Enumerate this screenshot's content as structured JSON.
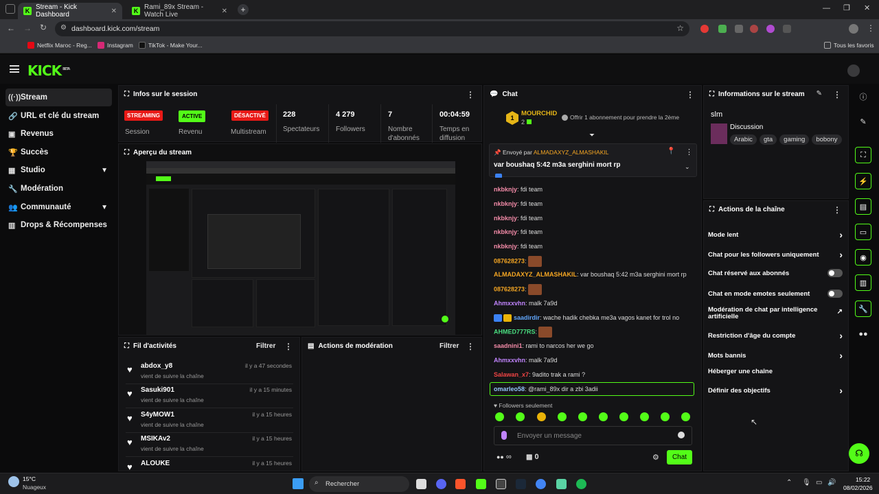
{
  "browser": {
    "tabs": [
      {
        "label": "Stream - Kick Dashboard"
      },
      {
        "label": "Rami_89x Stream - Watch Live"
      }
    ],
    "url": "dashboard.kick.com/stream",
    "bookmarks": [
      "Netflix Maroc - Reg...",
      "Instagram",
      "TikTok - Make Your..."
    ],
    "all_bookmarks": "Tous les favoris"
  },
  "header": {
    "logo": "KICK",
    "beta": "BETA"
  },
  "sidebar": {
    "items": [
      {
        "label": "Stream",
        "icon": "broadcast-icon"
      },
      {
        "label": "URL et clé du stream",
        "icon": "link-icon"
      },
      {
        "label": "Revenus",
        "icon": "wallet-icon"
      },
      {
        "label": "Succès",
        "icon": "trophy-icon"
      },
      {
        "label": "Studio",
        "icon": "studio-icon"
      },
      {
        "label": "Modération",
        "icon": "wrench-icon"
      },
      {
        "label": "Communauté",
        "icon": "people-icon"
      },
      {
        "label": "Drops & Récompenses",
        "icon": "drops-icon"
      }
    ]
  },
  "session": {
    "title": "Infos sur le session",
    "streaming_badge": "STREAMING",
    "streaming_label": "Session",
    "active_badge": "ACTIVE",
    "active_label": "Revenu Partenaire",
    "multi_badge": "DÉSACTIVÉ",
    "multi_label": "Multistream",
    "viewers_val": "228",
    "viewers_label": "Spectateurs",
    "followers_val": "4 279",
    "followers_label": "Followers",
    "subs_val": "7",
    "subs_label": "Nombre d'abonnés",
    "time_val": "00:04:59",
    "time_label": "Temps en diffusion"
  },
  "preview": {
    "title": "Aperçu du stream"
  },
  "activity": {
    "title": "Fil d'activités",
    "filter": "Filtrer",
    "items": [
      {
        "name": "abdox_y8",
        "sub": "vient de suivre la chaîne",
        "time": "il y a 47 secondes"
      },
      {
        "name": "Sasuki901",
        "sub": "vient de suivre la chaîne",
        "time": "il y a 15 minutes"
      },
      {
        "name": "S4yMOW1",
        "sub": "vient de suivre la chaîne",
        "time": "il y a 15 heures"
      },
      {
        "name": "MSIKAv2",
        "sub": "vient de suivre la chaîne",
        "time": "il y a 15 heures"
      },
      {
        "name": "ALOUKE",
        "sub": "",
        "time": "il y a 15 heures"
      }
    ]
  },
  "moderation": {
    "title": "Actions de modération",
    "filter": "Filtrer"
  },
  "chat": {
    "title": "Chat",
    "top_user": "MOURCHID",
    "top_count": "2",
    "top_rank": "1",
    "offer": "Offrir 1 abonnement pour prendre la 2ème",
    "pinned_by_label": "Envoyé par",
    "pinned_by": "ALMADAXYZ_ALMASHAKIL",
    "pinned_msg": "var boushaq 5:42 m3a serghini mort rp",
    "messages": [
      {
        "user": "nkbknjy",
        "text": ": fdi team",
        "color": "#f38ba8"
      },
      {
        "user": "nkbknjy",
        "text": ": fdi team",
        "color": "#f38ba8"
      },
      {
        "user": "nkbknjy",
        "text": ": fdi team",
        "color": "#f38ba8"
      },
      {
        "user": "nkbknjy",
        "text": ": fdi team",
        "color": "#f38ba8"
      },
      {
        "user": "nkbknjy",
        "text": ": fdi team",
        "color": "#f38ba8"
      },
      {
        "user": "087628273",
        "text": ":",
        "color": "#f5a623"
      },
      {
        "user": "ALMADAXYZ_ALMASHAKIL",
        "text": ": var boushaq 5:42 m3a serghini mort rp",
        "color": "#f5a623"
      },
      {
        "user": "087628273",
        "text": ":",
        "color": "#f5a623"
      },
      {
        "user": "Ahmxxvhn",
        "text": ": malk 7a9d",
        "color": "#c084fc"
      },
      {
        "user": "saadirdir",
        "text": ": wache hadik chebka me3a vagos kanet for trol no",
        "color": "#60a5fa"
      },
      {
        "user": "AHMED777RS",
        "text": ":",
        "color": "#4ade80"
      },
      {
        "user": "saadnini1",
        "text": ": rami to narcos her we go",
        "color": "#f38ba8"
      },
      {
        "user": "Ahmxxvhn",
        "text": ": malk 7a9d",
        "color": "#c084fc"
      },
      {
        "user": "Salawan_x7",
        "text": ": 9adito trak a rami ?",
        "color": "#ef4444"
      },
      {
        "user": "omarleo58",
        "text": ": @rami_89x dir a zbi 3adii",
        "color": "#93c5fd"
      }
    ],
    "followers_only": "Followers seulement",
    "input_placeholder": "Envoyer un message",
    "infinity": "∞",
    "gift_count": "0",
    "send": "Chat"
  },
  "stream_info": {
    "title": "Informations sur le stream",
    "stream_title": "slm",
    "category": "Discussion",
    "tags": [
      "Arabic",
      "gta",
      "gaming",
      "bobony"
    ]
  },
  "channel_actions": {
    "title": "Actions de la chaîne",
    "items": [
      {
        "label": "Mode lent",
        "control": "arrow"
      },
      {
        "label": "Chat pour les followers uniquement",
        "control": "arrow"
      },
      {
        "label": "Chat réservé aux abonnés",
        "control": "toggle"
      },
      {
        "label": "Chat en mode emotes seulement",
        "control": "toggle"
      },
      {
        "label": "Modération de chat par intelligence artificielle",
        "control": "external"
      },
      {
        "label": "Restriction d'âge du compte",
        "control": "arrow"
      },
      {
        "label": "Mots bannis",
        "control": "arrow"
      },
      {
        "label": "Héberger une chaîne",
        "control": "none"
      },
      {
        "label": "Définir des objectifs",
        "control": "arrow"
      }
    ]
  },
  "taskbar": {
    "weather_temp": "15°C",
    "weather_desc": "Nuageux",
    "search": "Rechercher",
    "time": "15:22",
    "date": "08/02/2026"
  },
  "colors": {
    "accent": "#53fc18",
    "streaming": "#e91916",
    "bg": "#0b0b0c",
    "panel": "#141416"
  }
}
